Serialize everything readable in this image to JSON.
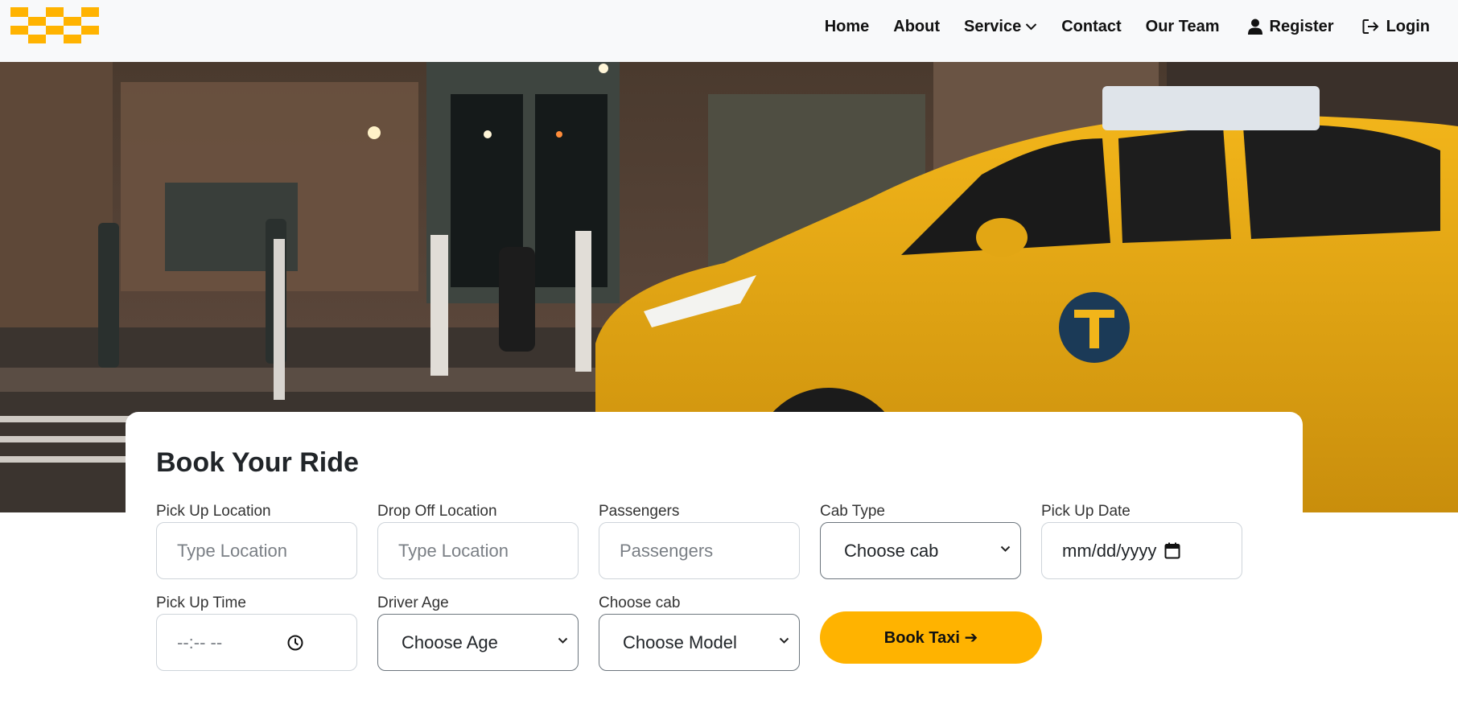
{
  "nav": {
    "items": [
      {
        "label": "Home"
      },
      {
        "label": "About"
      },
      {
        "label": "Service"
      },
      {
        "label": "Contact"
      },
      {
        "label": "Our Team"
      },
      {
        "label": "Register"
      },
      {
        "label": "Login"
      }
    ]
  },
  "booking": {
    "title": "Book Your Ride",
    "fields": {
      "pickup_location": {
        "label": "Pick Up Location",
        "placeholder": "Type Location"
      },
      "dropoff_location": {
        "label": "Drop Off Location",
        "placeholder": "Type Location"
      },
      "passengers": {
        "label": "Passengers",
        "placeholder": "Passengers"
      },
      "cab_type": {
        "label": "Cab Type",
        "value": "Choose cab"
      },
      "pickup_date": {
        "label": "Pick Up Date",
        "value": "mm/dd/yyyy"
      },
      "pickup_time": {
        "label": "Pick Up Time",
        "value": "--:-- --"
      },
      "driver_age": {
        "label": "Driver Age",
        "value": "Choose Age"
      },
      "choose_cab": {
        "label": "Choose cab",
        "value": "Choose Model"
      }
    },
    "submit_label": "Book Taxi ➔"
  },
  "colors": {
    "brand_yellow": "#ffb300",
    "navbar_bg": "#f8f9fa"
  },
  "icons": [
    "taxi-checker-logo",
    "chevron-down-icon",
    "user-icon",
    "login-icon",
    "calendar-icon",
    "clock-icon"
  ]
}
